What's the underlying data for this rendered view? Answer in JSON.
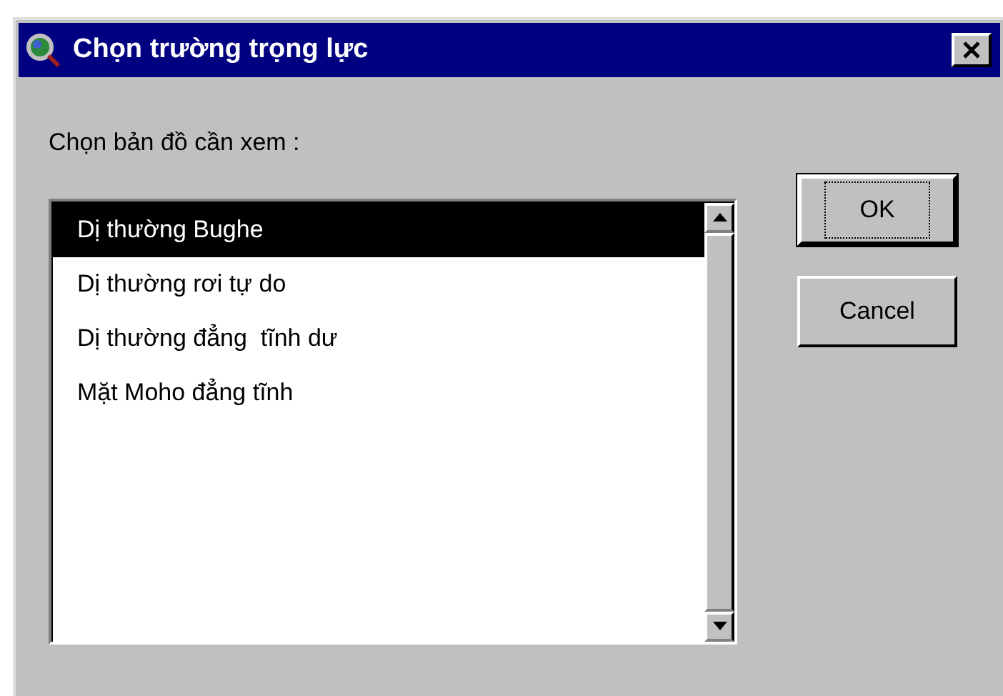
{
  "window": {
    "title": "Chọn trường trọng lực"
  },
  "prompt": "Chọn bản đồ cần xem :",
  "list": {
    "items": [
      {
        "label": "Dị thường Bughe",
        "selected": true
      },
      {
        "label": "Dị thường rơi tự do",
        "selected": false
      },
      {
        "label": "Dị thường đẳng  tĩnh dư",
        "selected": false
      },
      {
        "label": "Mặt Moho đẳng tĩnh",
        "selected": false
      }
    ]
  },
  "buttons": [
    {
      "label": "OK",
      "default": true
    },
    {
      "label": "Cancel",
      "default": false
    }
  ]
}
